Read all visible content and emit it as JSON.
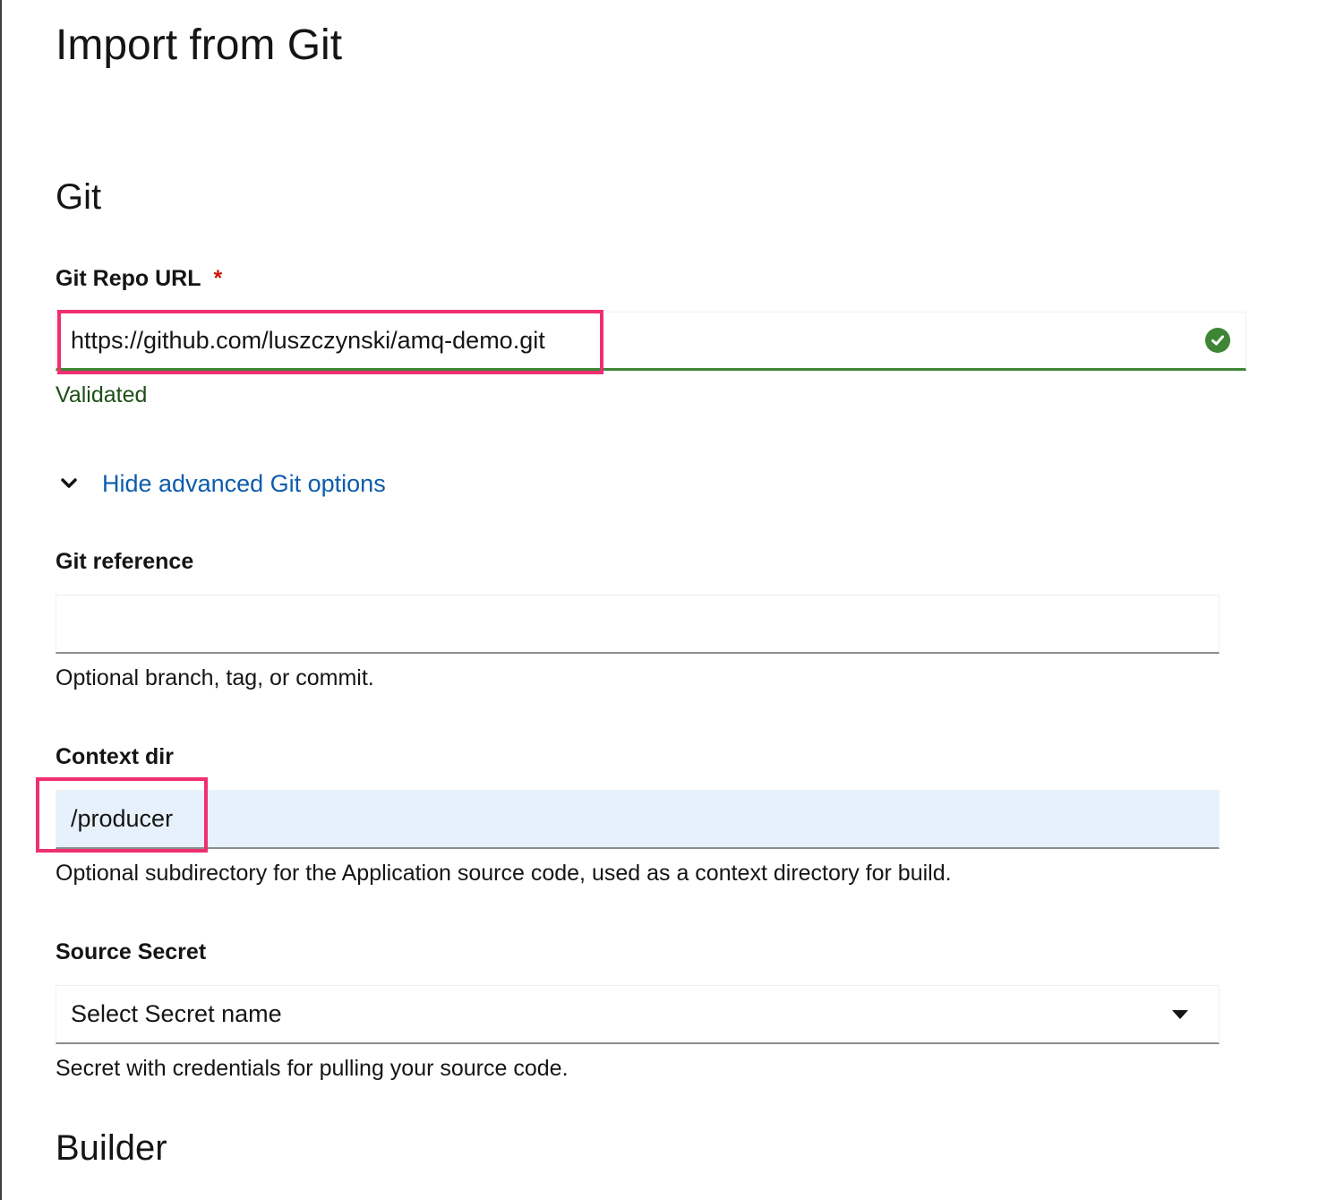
{
  "page": {
    "title": "Import from Git"
  },
  "sections": {
    "git_title": "Git",
    "builder_title": "Builder"
  },
  "git_repo_url": {
    "label": "Git Repo URL",
    "required_marker": "*",
    "value": "https://github.com/luszczynski/amq-demo.git",
    "status_text": "Validated",
    "status_icon": "check-circle-icon",
    "status_color": "#3e8635"
  },
  "advanced_toggle": {
    "label": "Hide advanced Git options",
    "icon": "chevron-down-icon"
  },
  "git_reference": {
    "label": "Git reference",
    "value": "",
    "helper": "Optional branch, tag, or commit."
  },
  "context_dir": {
    "label": "Context dir",
    "value": "/producer",
    "helper": "Optional subdirectory for the Application source code, used as a context directory for build."
  },
  "source_secret": {
    "label": "Source Secret",
    "selected": "Select Secret name",
    "icon": "caret-down-icon",
    "helper": "Secret with credentials for pulling your source code."
  },
  "colors": {
    "highlight": "#ef2f72",
    "link": "#0b5cad",
    "success": "#3e8635",
    "required": "#c9190b",
    "autofill_bg": "#e7f1fd"
  }
}
